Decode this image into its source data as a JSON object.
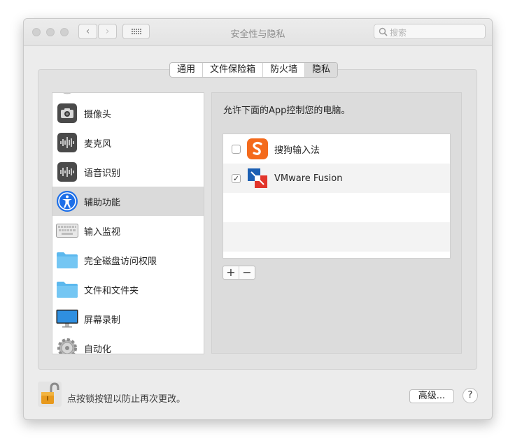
{
  "window": {
    "title": "安全性与隐私"
  },
  "search": {
    "placeholder": "搜索"
  },
  "tabs": [
    {
      "label": "通用"
    },
    {
      "label": "文件保险箱"
    },
    {
      "label": "防火墙"
    },
    {
      "label": "隐私",
      "active": true
    }
  ],
  "sidebar": {
    "items": [
      {
        "label": "摄像头",
        "icon": "camera-icon"
      },
      {
        "label": "麦克风",
        "icon": "microphone-icon"
      },
      {
        "label": "语音识别",
        "icon": "speech-recognition-icon"
      },
      {
        "label": "辅助功能",
        "icon": "accessibility-icon",
        "selected": true
      },
      {
        "label": "输入监视",
        "icon": "keyboard-icon"
      },
      {
        "label": "完全磁盘访问权限",
        "icon": "folder-icon"
      },
      {
        "label": "文件和文件夹",
        "icon": "folder-icon"
      },
      {
        "label": "屏幕录制",
        "icon": "display-icon"
      },
      {
        "label": "自动化",
        "icon": "gear-icon"
      }
    ]
  },
  "main": {
    "heading": "允许下面的App控制您的电脑。",
    "apps": [
      {
        "name": "搜狗输入法",
        "checked": false,
        "icon": "sogou-icon"
      },
      {
        "name": "VMware Fusion",
        "checked": true,
        "icon": "vmware-fusion-icon"
      }
    ],
    "add_label": "+",
    "remove_label": "−"
  },
  "footer": {
    "lock_text": "点按锁按钮以防止再次更改。",
    "advanced_label": "高级...",
    "help_label": "?"
  },
  "colors": {
    "accessibility_blue": "#1d6fe8",
    "sogou_orange": "#f46a1c",
    "vmware_blue": "#1b5fb3",
    "vmware_red": "#e2352b",
    "folder_blue": "#5bb8ee"
  }
}
